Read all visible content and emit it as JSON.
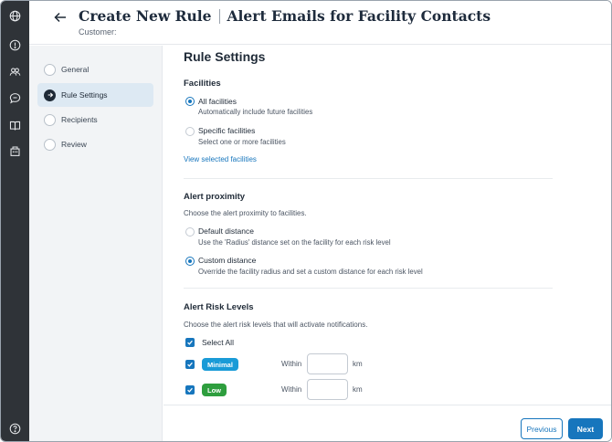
{
  "header": {
    "title": "Create New Rule",
    "subtitle": "Alert Emails for Facility Contacts",
    "customer_label": "Customer:"
  },
  "rail": {
    "icons": [
      "globe-icon",
      "info-icon",
      "people-icon",
      "chat-icon",
      "book-icon",
      "building-icon",
      "help-icon"
    ]
  },
  "steps": [
    {
      "label": "General",
      "state": "pending"
    },
    {
      "label": "Rule Settings",
      "state": "active"
    },
    {
      "label": "Recipients",
      "state": "pending"
    },
    {
      "label": "Review",
      "state": "pending"
    }
  ],
  "main": {
    "title": "Rule Settings",
    "facilities": {
      "heading": "Facilities",
      "options": [
        {
          "label": "All facilities",
          "help": "Automatically include future facilities",
          "checked": true
        },
        {
          "label": "Specific facilities",
          "help": "Select one or more facilities",
          "checked": false
        }
      ],
      "link": "View selected facilities"
    },
    "proximity": {
      "heading": "Alert proximity",
      "description": "Choose the alert proximity to facilities.",
      "options": [
        {
          "label": "Default distance",
          "help": "Use the 'Radius' distance set on the facility for each risk level",
          "checked": false
        },
        {
          "label": "Custom distance",
          "help": "Override the facility radius and set a custom distance for each risk level",
          "checked": true
        }
      ]
    },
    "risk": {
      "heading": "Alert Risk Levels",
      "description": "Choose the alert risk levels that will activate notifications.",
      "select_all": "Select All",
      "levels": [
        {
          "label": "Minimal",
          "color": "#1a9bd7",
          "within": "Within",
          "unit": "km",
          "value": ""
        },
        {
          "label": "Low",
          "color": "#2e9e3e",
          "within": "Within",
          "unit": "km",
          "value": ""
        }
      ]
    }
  },
  "footer": {
    "previous": "Previous",
    "next": "Next"
  },
  "colors": {
    "accent": "#1776bd",
    "rail": "#2f3338",
    "sidebar": "#f2f4f6",
    "active_step": "#dde9f3"
  }
}
